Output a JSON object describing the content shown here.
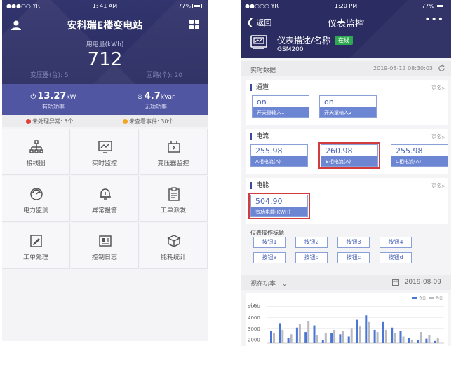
{
  "left": {
    "status": {
      "carrier": "●●●○○ YR",
      "time": "1: 41 AM",
      "battery": "77%"
    },
    "title": "安科瑞E楼变电站",
    "usage_label": "用电量(kWh)",
    "usage_value": "712",
    "transformers": "变压器(台): 5",
    "loops": "回路(个): 20",
    "active_power": {
      "value": "13.27",
      "unit": "kW",
      "label": "有功功率"
    },
    "reactive_power": {
      "value": "4.7",
      "unit": "kVar",
      "label": "无功功率"
    },
    "alert_unhandled": "未处理异常: 5个",
    "alert_unviewed": "未查看事件: 30个",
    "grid": [
      {
        "label": "接线图",
        "icon": "wiring-diagram-icon"
      },
      {
        "label": "实时监控",
        "icon": "monitor-chart-icon"
      },
      {
        "label": "变压器监控",
        "icon": "transformer-icon"
      },
      {
        "label": "电力监测",
        "icon": "gauge-icon"
      },
      {
        "label": "异常报警",
        "icon": "bell-icon"
      },
      {
        "label": "工单派发",
        "icon": "clipboard-icon"
      },
      {
        "label": "工单处理",
        "icon": "edit-icon"
      },
      {
        "label": "控制日志",
        "icon": "log-icon"
      },
      {
        "label": "能耗统计",
        "icon": "cube-icon"
      }
    ]
  },
  "right": {
    "status": {
      "carrier": "●●○○○ YR",
      "time": "1:20 PM",
      "battery": "77%"
    },
    "back": "返回",
    "title": "仪表监控",
    "device_desc": "仪表描述/名称",
    "online": "在线",
    "model": "GSM200",
    "realtime_label": "实时数据",
    "realtime_time": "2019-08-12 08:30:03",
    "more": "更多>",
    "channel": {
      "title": "通道",
      "items": [
        {
          "value": "on",
          "label": "开关量输入1"
        },
        {
          "value": "on",
          "label": "开关量输入2"
        }
      ]
    },
    "current": {
      "title": "电流",
      "items": [
        {
          "value": "255.98",
          "label": "A相电流(A)"
        },
        {
          "value": "260.98",
          "label": "B相电流(A)"
        },
        {
          "value": "255.98",
          "label": "C相电流(A)"
        }
      ]
    },
    "energy": {
      "title": "电能",
      "items": [
        {
          "value": "504.90",
          "label": "有功电能(KWH)"
        }
      ]
    },
    "buttons_title": "仪表操作标题",
    "buttons": [
      "按钮1",
      "按钮2",
      "按钮3",
      "按钮4",
      "按钮a",
      "按钮b",
      "按钮c",
      "按钮d"
    ],
    "chart_head": {
      "label": "视在功率",
      "date": "2019-08-09"
    }
  },
  "chart_data": {
    "type": "bar",
    "ylabel": "(w)",
    "yticks": [
      2000,
      3000,
      4000,
      5000
    ],
    "ylim": [
      1700,
      5600
    ],
    "legend": [
      "今日",
      "昨日"
    ],
    "series": [
      {
        "name": "今日",
        "color": "#4a76d4",
        "values": [
          2800,
          3500,
          2200,
          3100,
          2700,
          3300,
          2000,
          2600,
          2500,
          2300,
          3800,
          4200,
          2900,
          3600,
          3100,
          2800,
          2200,
          2000,
          2100,
          1900
        ]
      },
      {
        "name": "昨日",
        "color": "#b9b9c2",
        "values": [
          2600,
          2900,
          2500,
          3400,
          3700,
          2400,
          2600,
          2900,
          2800,
          3000,
          3200,
          3600,
          2700,
          2900,
          2600,
          2300,
          2000,
          2700,
          2400,
          2200
        ]
      }
    ]
  }
}
